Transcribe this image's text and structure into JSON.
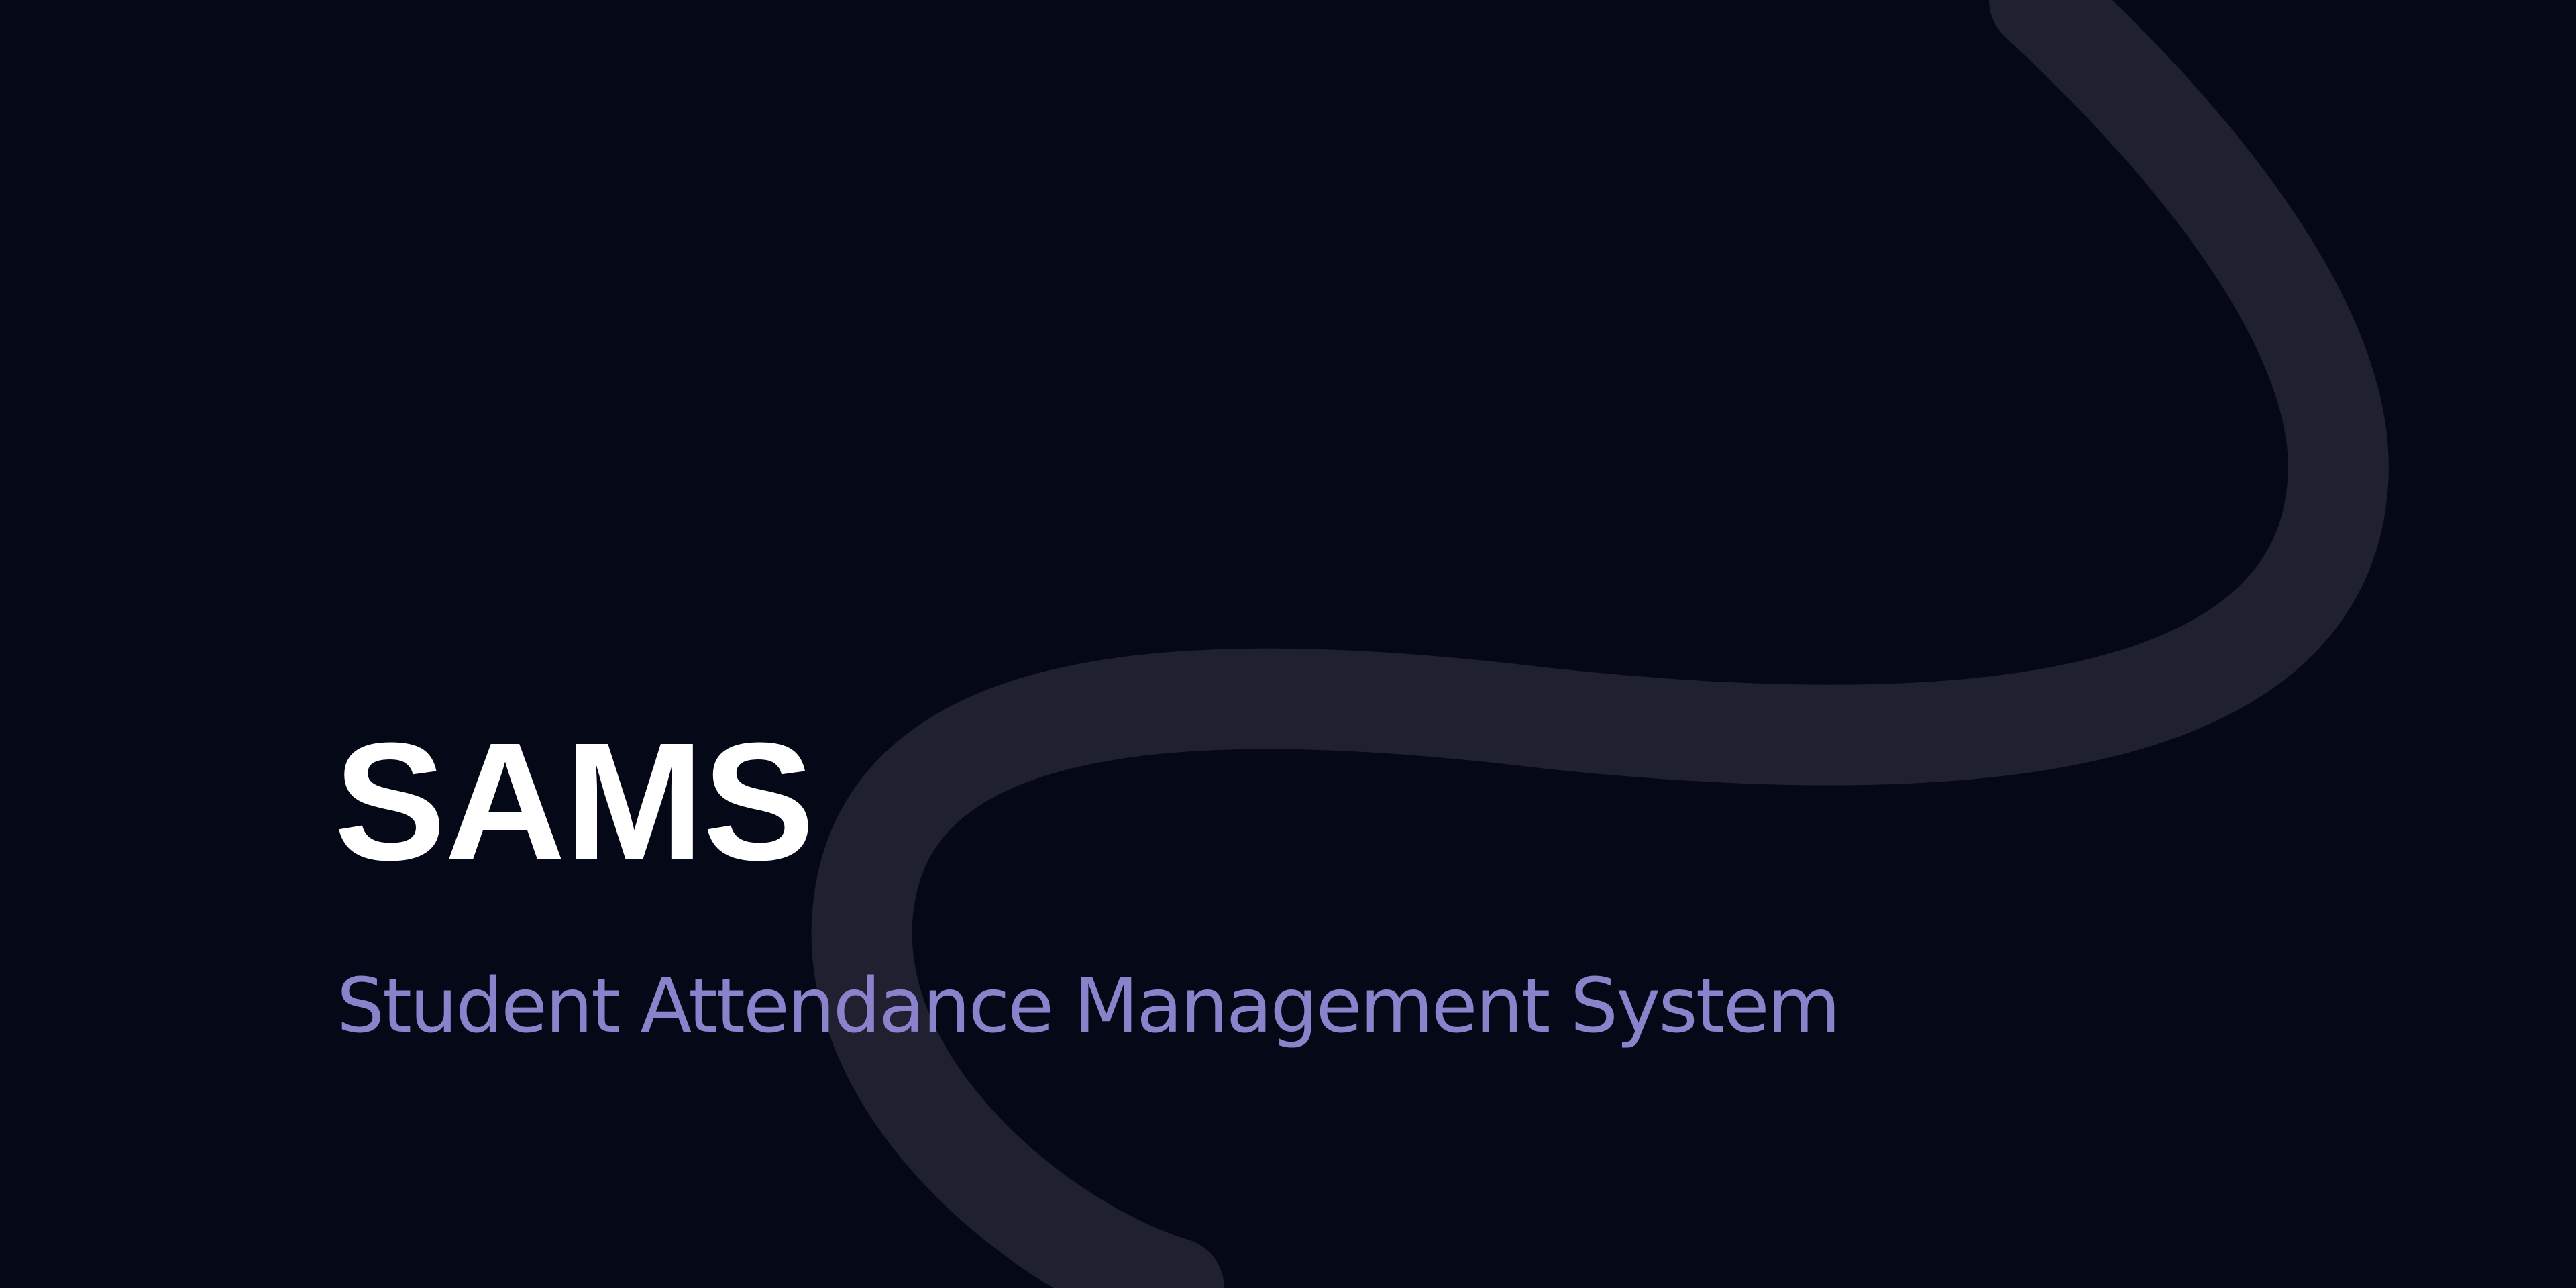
{
  "hero": {
    "title": "SAMS",
    "subtitle": "Student Attendance Management System"
  },
  "colors": {
    "background": "#050816",
    "title": "#ffffff",
    "subtitle": "#8b82cc",
    "swirl": "#1f2030"
  }
}
